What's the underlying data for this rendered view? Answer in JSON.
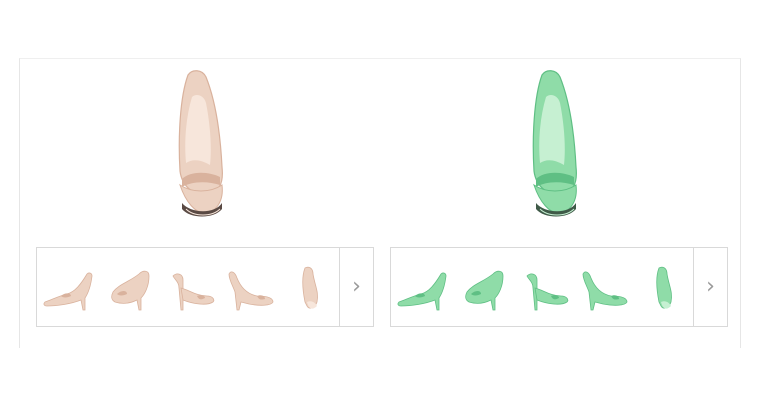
{
  "products": [
    {
      "id": "nude",
      "color_name": "nude",
      "colors": {
        "fill": "#ecd2c2",
        "shade": "#d9b29d",
        "light": "#f7e6db",
        "sole": "#5a4a44"
      },
      "thumbnails": [
        "side-view",
        "three-quarter-view",
        "front-view",
        "side-view-2",
        "back-view"
      ],
      "next_icon": "chevron-right-icon"
    },
    {
      "id": "mint",
      "color_name": "mint green",
      "colors": {
        "fill": "#8fdca8",
        "shade": "#5fbf84",
        "light": "#c6f0d2",
        "sole": "#3f5a48"
      },
      "thumbnails": [
        "side-view",
        "three-quarter-view",
        "front-view",
        "side-view-2",
        "back-view"
      ],
      "next_icon": "chevron-right-icon"
    }
  ],
  "glyphs": {
    "chevron": "›"
  }
}
